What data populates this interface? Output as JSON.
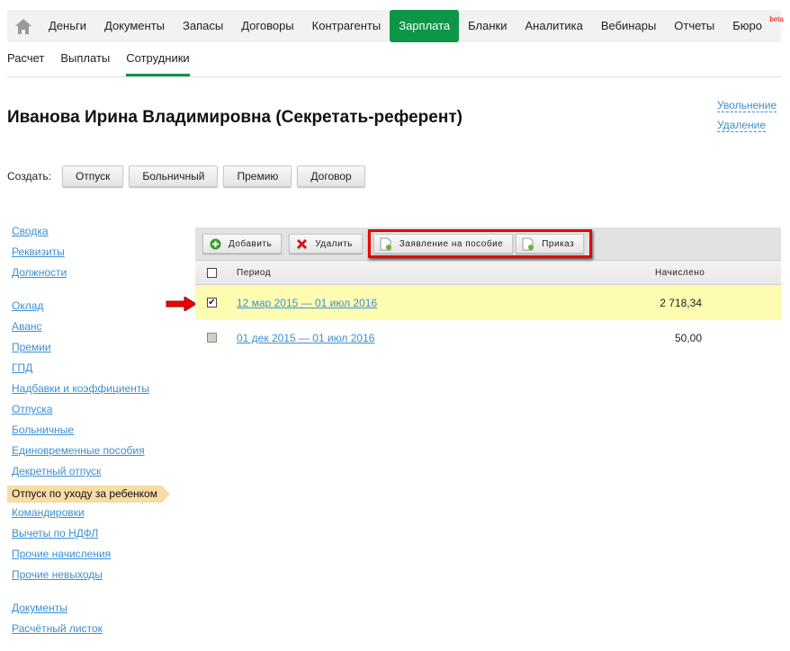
{
  "nav": {
    "items": [
      "Деньги",
      "Документы",
      "Запасы",
      "Договоры",
      "Контрагенты",
      "Зарплата",
      "Бланки",
      "Аналитика",
      "Вебинары",
      "Отчеты",
      "Бюро"
    ],
    "active": "Зарплата",
    "beta": "beta"
  },
  "subnav": {
    "items": [
      "Расчет",
      "Выплаты",
      "Сотрудники"
    ],
    "active": "Сотрудники"
  },
  "title": "Иванова Ирина Владимировна (Секретать-референт)",
  "right_links": [
    "Увольнение",
    "Удаление"
  ],
  "create": {
    "label": "Создать:",
    "buttons": [
      "Отпуск",
      "Больничный",
      "Премию",
      "Договор"
    ]
  },
  "sidebar": {
    "groups": [
      [
        "Сводка",
        "Реквизиты",
        "Должности"
      ],
      [
        "Оклад",
        "Аванс",
        "Премии",
        "ГПД",
        "Надбавки и коэффициенты",
        "Отпуска",
        "Больничные",
        "Единовременные пособия",
        "Декретный отпуск",
        "Отпуск по уходу за ребенком",
        "Командировки",
        "Вычеты по НДФЛ",
        "Прочие начисления",
        "Прочие невыходы"
      ],
      [
        "Документы",
        "Расчётный листок"
      ]
    ],
    "active": "Отпуск по уходу за ребенком"
  },
  "toolbar": {
    "add": "Добавить",
    "delete": "Удалить",
    "claim": "Заявление на пособие",
    "order": "Приказ"
  },
  "table": {
    "headers": {
      "period": "Период",
      "accrued": "Начислено"
    },
    "rows": [
      {
        "period": "12 мар 2015 — 01 июл 2016",
        "accrued": "2 718,34",
        "checked": true
      },
      {
        "period": "01 дек 2015 — 01 июл 2016",
        "accrued": "50,00",
        "checked": false
      }
    ]
  },
  "colors": {
    "brand": "#0d9648",
    "link": "#3b8fd6",
    "highlight": "#e00000"
  }
}
